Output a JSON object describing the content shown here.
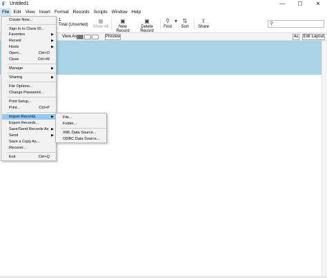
{
  "window": {
    "title": "Untitled1",
    "app_icon": "filemaker-icon",
    "minimize": "—",
    "maximize": "☐",
    "close": "✕"
  },
  "menubar": {
    "items": [
      "File",
      "Edit",
      "View",
      "Insert",
      "Format",
      "Records",
      "Scripts",
      "Window",
      "Help"
    ],
    "active": "File"
  },
  "toolbar": {
    "record_count": "1",
    "record_total": "Total (Unsorted)",
    "show_all": "Show All",
    "new_record": "New Record",
    "delete_record": "Delete Record",
    "find": "Find",
    "sort": "Sort",
    "share": "Share",
    "search_placeholder": ""
  },
  "layout_bar": {
    "view_as": "View As",
    "preview": "Preview",
    "ap": "Aa",
    "edit_layout": "Edit Layout"
  },
  "colors": {
    "header_band": "#a9d3e6",
    "menu_highlight": "#91c9f7"
  },
  "file_menu": {
    "items": [
      {
        "label": "Create New...",
        "shortcut": "",
        "submenu": false
      },
      {
        "label": "Sign In to Claris ID...",
        "shortcut": "",
        "submenu": false
      },
      {
        "label": "Favorites",
        "shortcut": "",
        "submenu": true
      },
      {
        "label": "Recent",
        "shortcut": "",
        "submenu": true
      },
      {
        "label": "Hosts",
        "shortcut": "",
        "submenu": true
      },
      {
        "label": "Open...",
        "shortcut": "Ctrl+O",
        "submenu": false
      },
      {
        "label": "Close",
        "shortcut": "Ctrl+W",
        "submenu": false
      },
      {
        "label": "Manage",
        "shortcut": "",
        "submenu": true
      },
      {
        "label": "Sharing",
        "shortcut": "",
        "submenu": true
      },
      {
        "label": "File Options...",
        "shortcut": "",
        "submenu": false
      },
      {
        "label": "Change Password...",
        "shortcut": "",
        "submenu": false
      },
      {
        "label": "Print Setup...",
        "shortcut": "",
        "submenu": false
      },
      {
        "label": "Print...",
        "shortcut": "Ctrl+P",
        "submenu": false
      },
      {
        "label": "Import Records",
        "shortcut": "",
        "submenu": true
      },
      {
        "label": "Export Records...",
        "shortcut": "",
        "submenu": false
      },
      {
        "label": "Save/Send Records As",
        "shortcut": "",
        "submenu": true
      },
      {
        "label": "Send",
        "shortcut": "",
        "submenu": true
      },
      {
        "label": "Save a Copy As...",
        "shortcut": "",
        "submenu": false
      },
      {
        "label": "Recover...",
        "shortcut": "",
        "submenu": false
      },
      {
        "label": "Exit",
        "shortcut": "Ctrl+Q",
        "submenu": false
      }
    ],
    "highlighted": "Import Records"
  },
  "import_submenu": {
    "items": [
      "File...",
      "Folder...",
      "XML Data Source...",
      "ODBC Data Source..."
    ]
  }
}
